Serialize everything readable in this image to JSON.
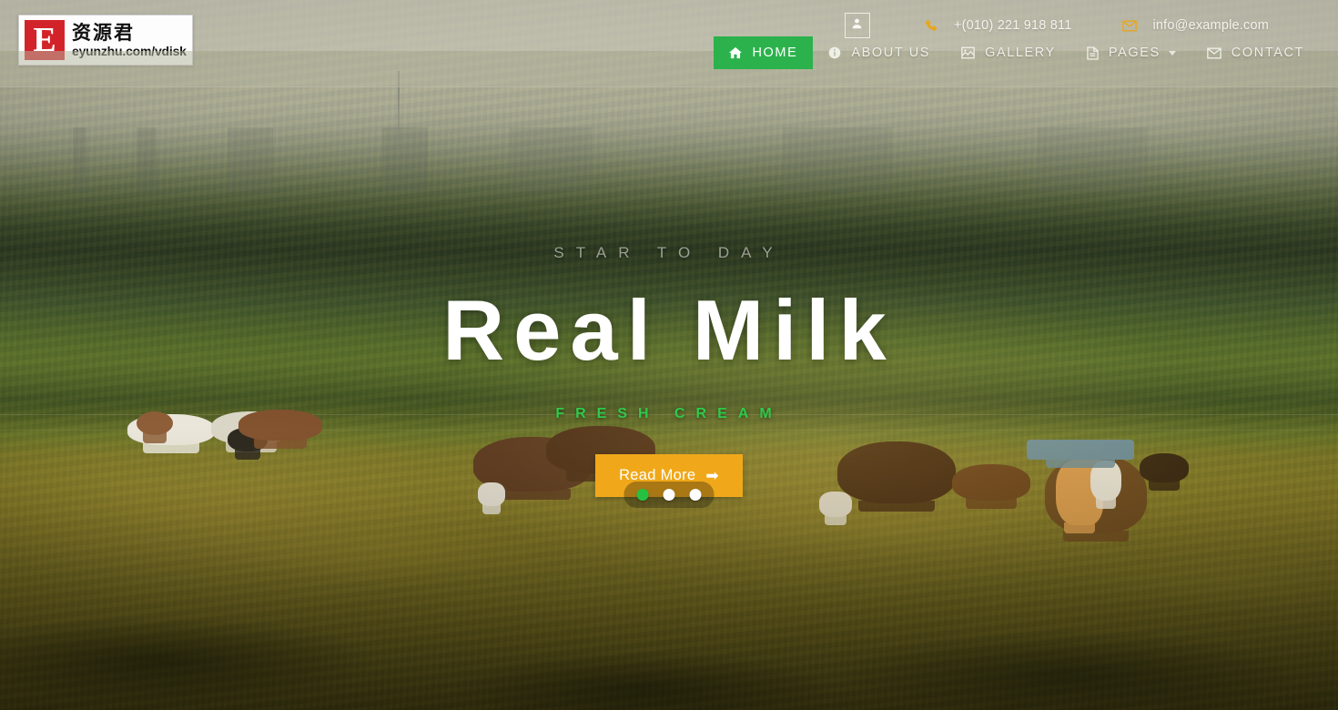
{
  "site": {
    "logo": {
      "mark_letter": "E",
      "name_cn": "资源君",
      "url": "eyunzhu.com/vdisk"
    }
  },
  "topbar": {
    "account_icon": "user-icon",
    "contacts": [
      {
        "icon": "phone-icon",
        "label": "+(010) 221 918 811"
      },
      {
        "icon": "envelope-icon",
        "label": "info@example.com"
      }
    ]
  },
  "nav": {
    "items": [
      {
        "label": "HOME",
        "icon": "home-icon",
        "active": true,
        "caret": false
      },
      {
        "label": "ABOUT US",
        "icon": "info-icon",
        "active": false,
        "caret": false
      },
      {
        "label": "GALLERY",
        "icon": "image-icon",
        "active": false,
        "caret": false
      },
      {
        "label": "PAGES",
        "icon": "file-icon",
        "active": false,
        "caret": true
      },
      {
        "label": "CONTACT",
        "icon": "envelope-icon",
        "active": false,
        "caret": false
      }
    ]
  },
  "hero": {
    "kicker": "STAR TO DAY",
    "title": "Real Milk",
    "subkicker": "FRESH CREAM",
    "cta_label": "Read More",
    "cta_arrow": "➡"
  },
  "carousel": {
    "slides": 3,
    "active_index": 0
  },
  "colors": {
    "accent_green": "#2bb24c",
    "accent_orange": "#f0a81a",
    "logo_red": "#d3232a",
    "subkicker_green": "#2fc94a",
    "header_overlay": "#cdccbd"
  }
}
